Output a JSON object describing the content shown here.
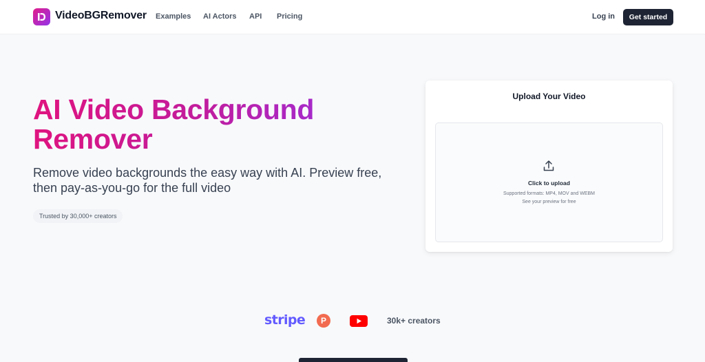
{
  "header": {
    "brand": "VideoBGRemover",
    "nav": [
      "Examples",
      "AI Actors",
      "API",
      "Pricing"
    ],
    "login_label": "Log in",
    "cta_label": "Get started"
  },
  "hero": {
    "title": "AI Video Background Remover",
    "subtitle": "Remove video backgrounds the easy way with AI. Preview free, then pay-as-you-go for the full video",
    "badge": "Trusted by 30,000+ creators"
  },
  "upload": {
    "title": "Upload Your Video",
    "main": "Click to upload",
    "formats": "Supported formats: MP4, MOV and WEBM",
    "note": "See your preview for free"
  },
  "trust": {
    "stripe": "stripe",
    "producthunt": "P",
    "creators": "30k+ creators"
  },
  "colors": {
    "accent_pink": "#e0137e",
    "accent_purple": "#9333ea",
    "cta_dark": "#1e2433",
    "stripe": "#635bff",
    "producthunt": "#f26b50",
    "youtube": "#ff0000"
  }
}
